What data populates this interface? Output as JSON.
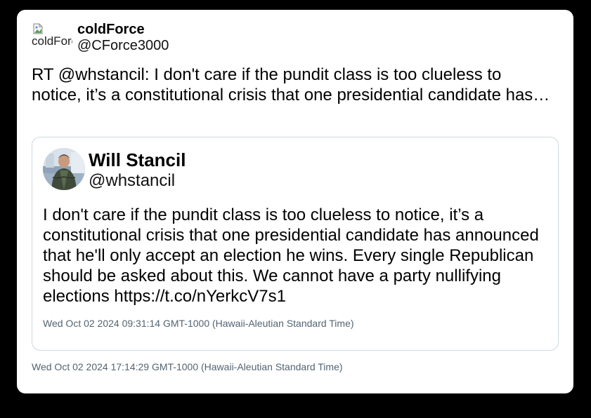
{
  "tweet": {
    "author": {
      "avatar_alt": "coldForce",
      "name": "coldForce",
      "handle": "@CForce3000"
    },
    "text": "RT @whstancil: I don't care if the pundit class is too clueless to notice, it’s a constitutional crisis that one presidential candidate has…",
    "timestamp": "Wed Oct 02 2024 17:14:29 GMT-1000 (Hawaii-Aleutian Standard Time)"
  },
  "quoted_tweet": {
    "author": {
      "name": "Will Stancil",
      "handle": "@whstancil"
    },
    "text": "I don't care if the pundit class is too clueless to notice, it’s a constitutional crisis that one presidential candidate has announced that he'll only accept an election he wins. Every single Republican should be asked about this. We cannot have a party nullifying elections https://t.co/nYerkcV7s1",
    "timestamp": "Wed Oct 02 2024 09:31:14 GMT-1000 (Hawaii-Aleutian Standard Time)"
  },
  "colors": {
    "page_background": "#000000",
    "card_background": "#ffffff",
    "border": "#cfd9de",
    "timestamp": "#536471"
  }
}
